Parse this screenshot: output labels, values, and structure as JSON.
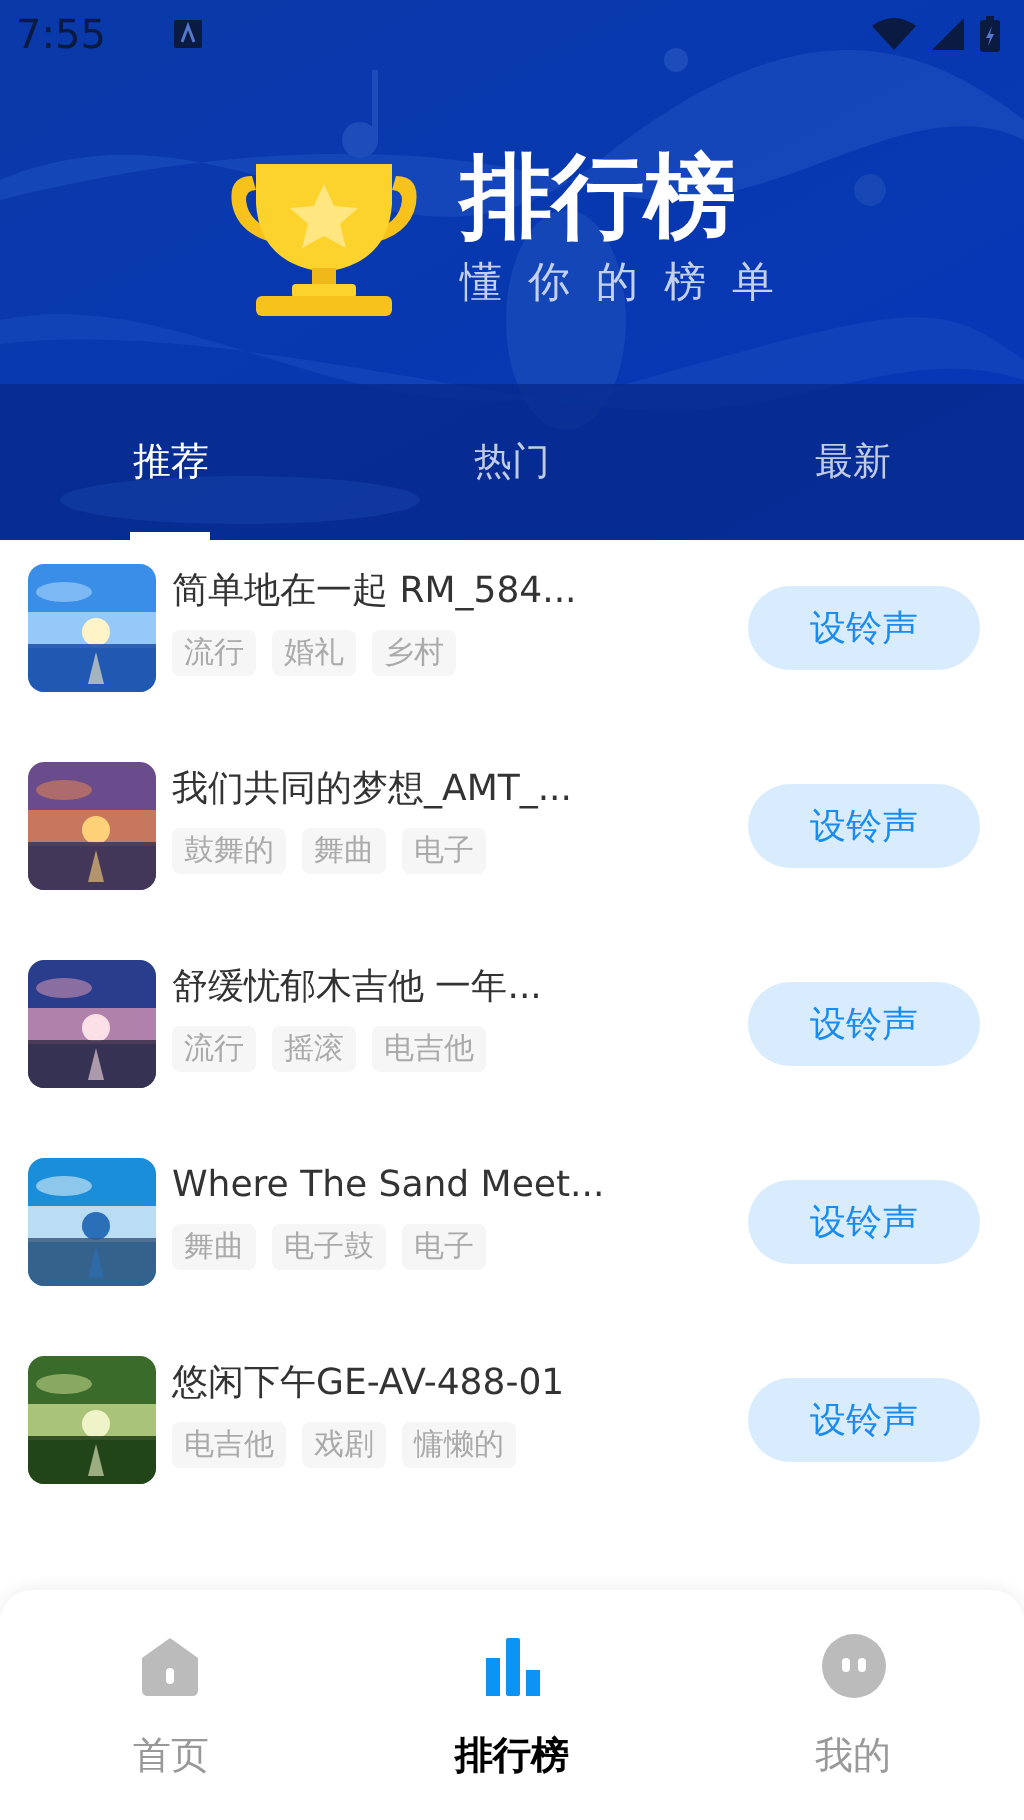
{
  "status_bar": {
    "time": "7:55"
  },
  "header": {
    "title": "排行榜",
    "subtitle": "懂你的榜单"
  },
  "tabs": [
    {
      "label": "推荐",
      "selected": true
    },
    {
      "label": "热门",
      "selected": false
    },
    {
      "label": "最新",
      "selected": false
    }
  ],
  "songs": [
    {
      "title": "简单地在一起 RM_584...",
      "tags": [
        "流行",
        "婚礼",
        "乡村"
      ],
      "button": "设铃声"
    },
    {
      "title": "我们共同的梦想_AMT_...",
      "tags": [
        "鼓舞的",
        "舞曲",
        "电子"
      ],
      "button": "设铃声"
    },
    {
      "title": "舒缓忧郁木吉他 一年...",
      "tags": [
        "流行",
        "摇滚",
        "电吉他"
      ],
      "button": "设铃声"
    },
    {
      "title": "Where The Sand Meet...",
      "tags": [
        "舞曲",
        "电子鼓",
        "电子"
      ],
      "button": "设铃声"
    },
    {
      "title": "悠闲下午GE-AV-488-01",
      "tags": [
        "电吉他",
        "戏剧",
        "慵懒的"
      ],
      "button": "设铃声"
    }
  ],
  "bottom_nav": [
    {
      "label": "首页",
      "selected": false
    },
    {
      "label": "排行榜",
      "selected": true
    },
    {
      "label": "我的",
      "selected": false
    }
  ]
}
